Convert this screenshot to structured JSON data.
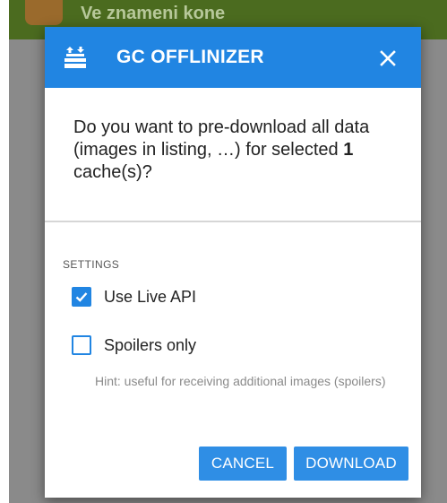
{
  "background": {
    "title": "Ve znameni kone"
  },
  "dialog": {
    "icon": "box-upload-icon",
    "title": "GC OFFLINIZER",
    "close_icon": "close-icon",
    "question_before": "Do you want to pre-download all data (images in listing, …) for selected ",
    "question_count": "1",
    "question_after": " cache(s)?",
    "section_label": "SETTINGS",
    "options": [
      {
        "label": "Use Live API",
        "checked": true
      },
      {
        "label": "Spoilers only",
        "checked": false
      }
    ],
    "hint": "Hint: useful for receiving additional images (spoilers)",
    "cancel_label": "CANCEL",
    "download_label": "DOWNLOAD"
  },
  "colors": {
    "accent": "#2185e2",
    "toolbar_bg": "#4b6b1f",
    "scrim": "#8a8a8a"
  }
}
